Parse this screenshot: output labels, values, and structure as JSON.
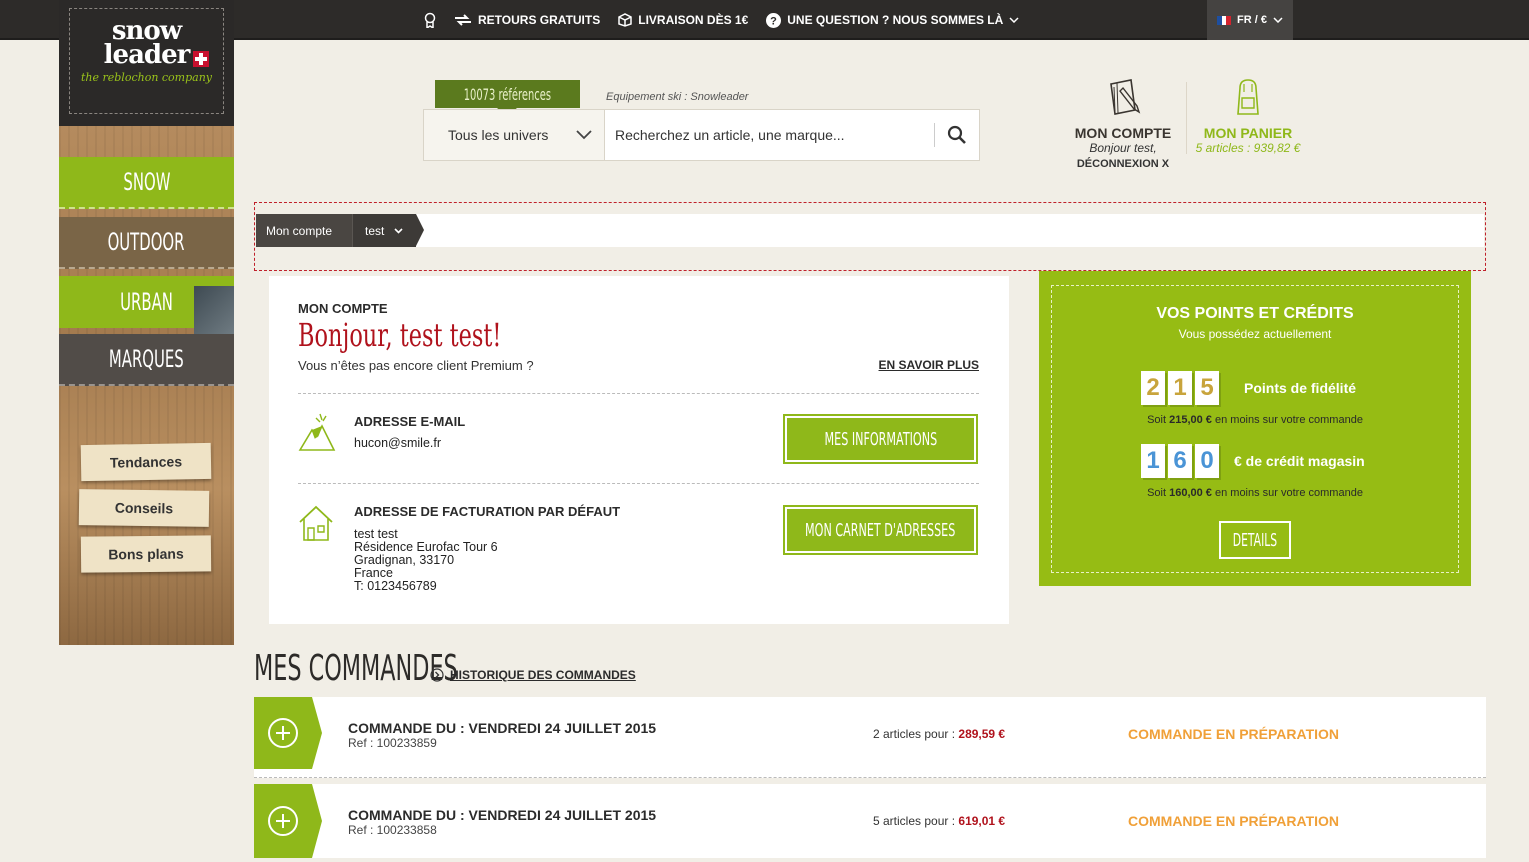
{
  "topbar": {
    "items": [
      {
        "icon": "ribbon-icon",
        "label": ""
      },
      {
        "icon": "return-arrows-icon",
        "label": "RETOURS GRATUITS"
      },
      {
        "icon": "box-icon",
        "label": "LIVRAISON DÈS 1€"
      },
      {
        "icon": "question-icon",
        "label": "UNE QUESTION ? NOUS SOMMES LÀ"
      }
    ],
    "lang": "FR / €"
  },
  "logo": {
    "line1": "snow",
    "line2": "leader",
    "tagline": "the reblochon company"
  },
  "sidebar": {
    "nav": [
      "SNOW",
      "OUTDOOR",
      "URBAN",
      "MARQUES"
    ],
    "papers": [
      "Tendances",
      "Conseils",
      "Bons plans"
    ]
  },
  "search": {
    "badge": "10073 références",
    "caption": "Equipement ski : Snowleader",
    "univers": "Tous les univers",
    "placeholder": "Recherchez un article, une marque..."
  },
  "account": {
    "title": "MON COMPTE",
    "greeting": "Bonjour test,",
    "logout": "DÉCONNEXION X"
  },
  "cart": {
    "title": "MON PANIER",
    "summary": "5 articles : 939,82 €"
  },
  "breadcrumb": {
    "root": "Mon compte",
    "current": "test"
  },
  "card": {
    "kicker": "MON COMPTE",
    "hello": "Bonjour, test test!",
    "premium": "Vous n’êtes pas encore client Premium ?",
    "more": "EN SAVOIR PLUS",
    "email_title": "ADRESSE E-MAIL",
    "email": "hucon@smile.fr",
    "info_btn": "MES INFORMATIONS",
    "billing_title": "ADRESSE DE FACTURATION PAR DÉFAUT",
    "billing_lines": [
      "test test",
      "Résidence Eurofac Tour 6",
      "Gradignan, 33170",
      "France",
      "T: 0123456789"
    ],
    "address_btn": "MON CARNET D'ADRESSES"
  },
  "points": {
    "title": "VOS POINTS ET CRÉDITS",
    "subtitle": "Vous possédez actuellement",
    "fidelity_digits": [
      "2",
      "1",
      "5"
    ],
    "fidelity_label": "Points de fidélité",
    "fidelity_note_pre": "Soit",
    "fidelity_amount": "215,00 €",
    "fidelity_note_post": "en moins sur votre commande",
    "credit_digits": [
      "1",
      "6",
      "0"
    ],
    "credit_label": "€ de crédit magasin",
    "credit_note_pre": "Soit",
    "credit_amount": "160,00 €",
    "credit_note_post": "en moins sur votre commande",
    "details_btn": "DETAILS"
  },
  "orders": {
    "title": "MES COMMANDES",
    "history_link": "HISTORIQUE DES COMMANDES",
    "list": [
      {
        "title": "COMMANDE DU : VENDREDI 24 JUILLET 2015",
        "ref": "Ref : 100233859",
        "items": "2 articles pour :",
        "amount": "289,59 €",
        "status": "COMMANDE EN PRÉPARATION"
      },
      {
        "title": "COMMANDE DU : VENDREDI 24 JUILLET 2015",
        "ref": "Ref : 100233858",
        "items": "5 articles pour :",
        "amount": "619,01 €",
        "status": "COMMANDE EN PRÉPARATION"
      }
    ]
  },
  "colors": {
    "green": "#8fb81a",
    "dark": "#2d2b29",
    "red": "#b0121c",
    "orange": "#f0a038"
  }
}
